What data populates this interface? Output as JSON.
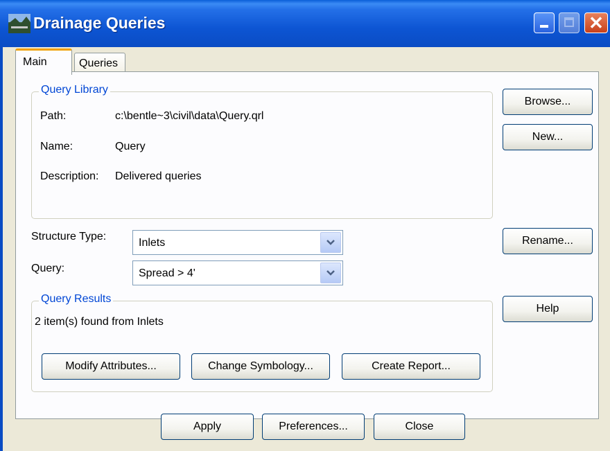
{
  "window": {
    "title": "Drainage Queries"
  },
  "tabs": [
    {
      "label": "Main"
    },
    {
      "label": "Queries"
    }
  ],
  "query_library": {
    "legend": "Query Library",
    "path_label": "Path:",
    "path_value": "c:\\bentle~3\\civil\\data\\Query.qrl",
    "name_label": "Name:",
    "name_value": "Query",
    "description_label": "Description:",
    "description_value": "Delivered queries"
  },
  "side_buttons": {
    "browse": "Browse...",
    "new": "New...",
    "rename": "Rename...",
    "help": "Help"
  },
  "structure_type": {
    "label": "Structure Type:",
    "value": "Inlets"
  },
  "query": {
    "label": "Query:",
    "value": "Spread > 4'"
  },
  "query_results": {
    "legend": "Query Results",
    "summary": "2 item(s) found from Inlets",
    "modify_attributes": "Modify Attributes...",
    "change_symbology": "Change Symbology...",
    "create_report": "Create Report..."
  },
  "footer": {
    "apply": "Apply",
    "preferences": "Preferences...",
    "close": "Close"
  }
}
